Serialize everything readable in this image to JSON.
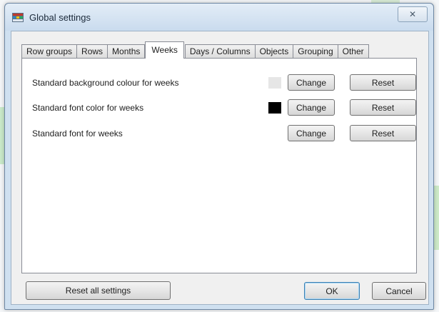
{
  "window": {
    "title": "Global settings",
    "close_glyph": "✕"
  },
  "tabs": [
    {
      "label": "Row groups",
      "active": false
    },
    {
      "label": "Rows",
      "active": false
    },
    {
      "label": "Months",
      "active": false
    },
    {
      "label": "Weeks",
      "active": true
    },
    {
      "label": "Days / Columns",
      "active": false
    },
    {
      "label": "Objects",
      "active": false
    },
    {
      "label": "Grouping",
      "active": false
    },
    {
      "label": "Other",
      "active": false
    }
  ],
  "settings": [
    {
      "label": "Standard background colour for weeks",
      "swatch_color": "#e6e6e6",
      "change_label": "Change",
      "reset_label": "Reset"
    },
    {
      "label": "Standard font color for weeks",
      "swatch_color": "#000000",
      "change_label": "Change",
      "reset_label": "Reset"
    },
    {
      "label": "Standard font for weeks",
      "swatch_color": null,
      "change_label": "Change",
      "reset_label": "Reset"
    }
  ],
  "footer": {
    "reset_all_label": "Reset all settings",
    "ok_label": "OK",
    "cancel_label": "Cancel"
  },
  "icons": {
    "title_icon": "settings-window-icon",
    "close_icon": "close-icon"
  }
}
